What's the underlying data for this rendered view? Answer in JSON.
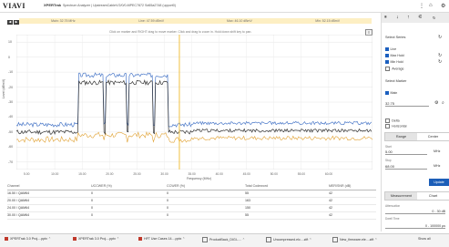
{
  "header": {
    "logo": "VIAVI",
    "brand": "XPERTrak",
    "title": "Spectrum Analyzer | UpstreamCableV/2/0/0-MPEC7872 Sd65a2748 (upport0)"
  },
  "markers_bar": {
    "items": [
      "Main: 32.75 MHz",
      "Line: 47.59 dBmV",
      "Max: 46.10 dBmV",
      "Min: 52.15 dBmV"
    ]
  },
  "plot": {
    "hint": "Click on marker and RIGHT drag to move marker. Click and drag to zoom in. Hold down shift key to pan.",
    "y_title": "Level (dBmV)",
    "x_title": "Frequency (MHz)"
  },
  "chart_data": {
    "type": "line",
    "xlim": [
      3,
      68
    ],
    "ylim": [
      -75,
      15
    ],
    "x_ticks": [
      "5.00",
      "10.00",
      "15.00",
      "20.00",
      "25.00",
      "30.00",
      "35.00",
      "40.00",
      "45.00",
      "50.00",
      "55.00",
      "60.00"
    ],
    "y_ticks": [
      "10",
      "0",
      "-10",
      "-20",
      "-30",
      "-40",
      "-50",
      "-60",
      "-70"
    ],
    "grid": true,
    "marker_x": 32.75,
    "colors": {
      "live": "#333333",
      "max_hold": "#4a78c8",
      "min_hold": "#e0a030",
      "marker": "#f0c040"
    }
  },
  "table": {
    "headers": [
      "Channel",
      "UCCWER (%)",
      "CCWER (%)",
      "Total Codeword",
      "MER/SNR (dB)"
    ],
    "rows": [
      [
        "16.50 / QAM64",
        "0",
        "0",
        "55",
        "42"
      ],
      [
        "20.00 / QAM64",
        "0",
        "0",
        "163",
        "42"
      ],
      [
        "24.00 / QAM64",
        "0",
        "0",
        "150",
        "42"
      ],
      [
        "30.00 / QAM64",
        "0",
        "0",
        "55",
        "42"
      ]
    ]
  },
  "panel": {
    "select_series": "Select Series",
    "series": [
      {
        "label": "Live",
        "checked": true
      },
      {
        "label": "Max Hold",
        "checked": true
      },
      {
        "label": "Min Hold",
        "checked": true
      },
      {
        "label": "Average",
        "checked": false
      }
    ],
    "select_marker": "Select Marker",
    "main_label": "Main",
    "marker_value": "32.75",
    "delta_label": "Delta",
    "horizontal_label": "Horizontal",
    "tab_range": "Range",
    "tab_center": "Center",
    "start_label": "Start",
    "start_value": "5.00",
    "stop_label": "Stop",
    "stop_value": "68.00",
    "unit": "MHz",
    "update": "Update",
    "tab_measurement": "Measurement",
    "tab_chart": "Chart",
    "attenuation_label": "Attenuation",
    "attenuation_value": "0 - 30 dB",
    "dwell_label": "Dwell Time",
    "dwell_value": "0 - 100000 μs"
  },
  "taskbar": {
    "items": [
      "XPERTrak 3.0 Proj....pptx",
      "XPERTrak 3.0 Proj....pptx",
      "HFT Use Cases 14....pptx",
      "ProductBack_DIGI-....",
      "Uncompressed.elc....zift",
      "New_firmware.ele....zift"
    ],
    "show_all": "Show all"
  }
}
